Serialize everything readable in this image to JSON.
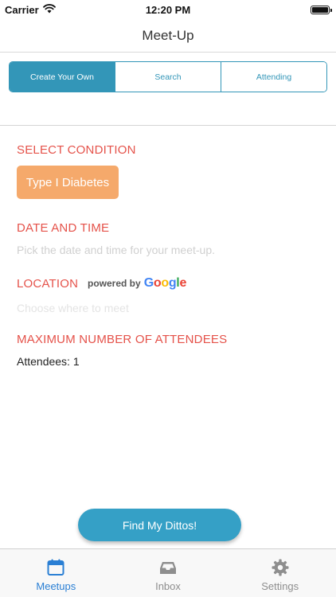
{
  "status_bar": {
    "carrier": "Carrier",
    "time": "12:20 PM"
  },
  "nav": {
    "title": "Meet-Up"
  },
  "segments": [
    {
      "label": "Create Your Own",
      "active": true
    },
    {
      "label": "Search",
      "active": false
    },
    {
      "label": "Attending",
      "active": false
    }
  ],
  "condition": {
    "heading": "SELECT CONDITION",
    "button_label": "Type I Diabetes"
  },
  "date_time": {
    "heading": "DATE AND TIME",
    "placeholder": "Pick the date and time for your meet-up."
  },
  "location": {
    "heading": "LOCATION",
    "powered_by": "powered by",
    "google": {
      "g1": "G",
      "o1": "o",
      "o2": "o",
      "g2": "g",
      "l": "l",
      "e": "e"
    },
    "placeholder": "Choose where to meet"
  },
  "attendees": {
    "heading": "MAXIMUM NUMBER OF ATTENDEES",
    "label": "Attendees: 1"
  },
  "cta": {
    "label": "Find My Dittos!"
  },
  "tabs": [
    {
      "label": "Meetups",
      "icon": "calendar-icon",
      "active": true
    },
    {
      "label": "Inbox",
      "icon": "inbox-tray-icon",
      "active": false
    },
    {
      "label": "Settings",
      "icon": "gear-icon",
      "active": false
    }
  ],
  "colors": {
    "accent": "#3396b8",
    "heading": "#e5524a",
    "condition_button": "#f5a96b",
    "cta": "#35a0c6",
    "tab_active": "#2a7fd4"
  }
}
